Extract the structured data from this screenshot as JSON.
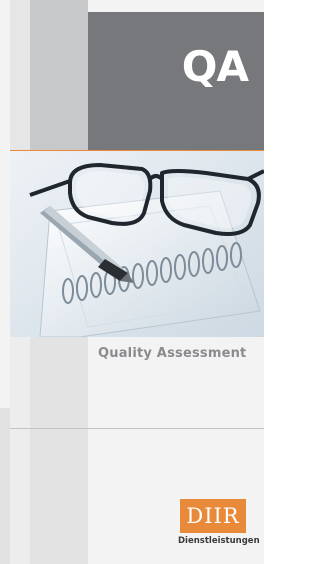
{
  "cover": {
    "title": "QA",
    "subtitle": "Quality Assessment"
  },
  "logo": {
    "mark": "DIIR",
    "tagline": "Dienstleistungen",
    "color": "#e98a3a"
  },
  "photo": {
    "subject": "eyeglasses-pen-notebook"
  },
  "colors": {
    "header": "#77787b",
    "accent": "#e98a3a",
    "background": "#f3f3f4"
  }
}
